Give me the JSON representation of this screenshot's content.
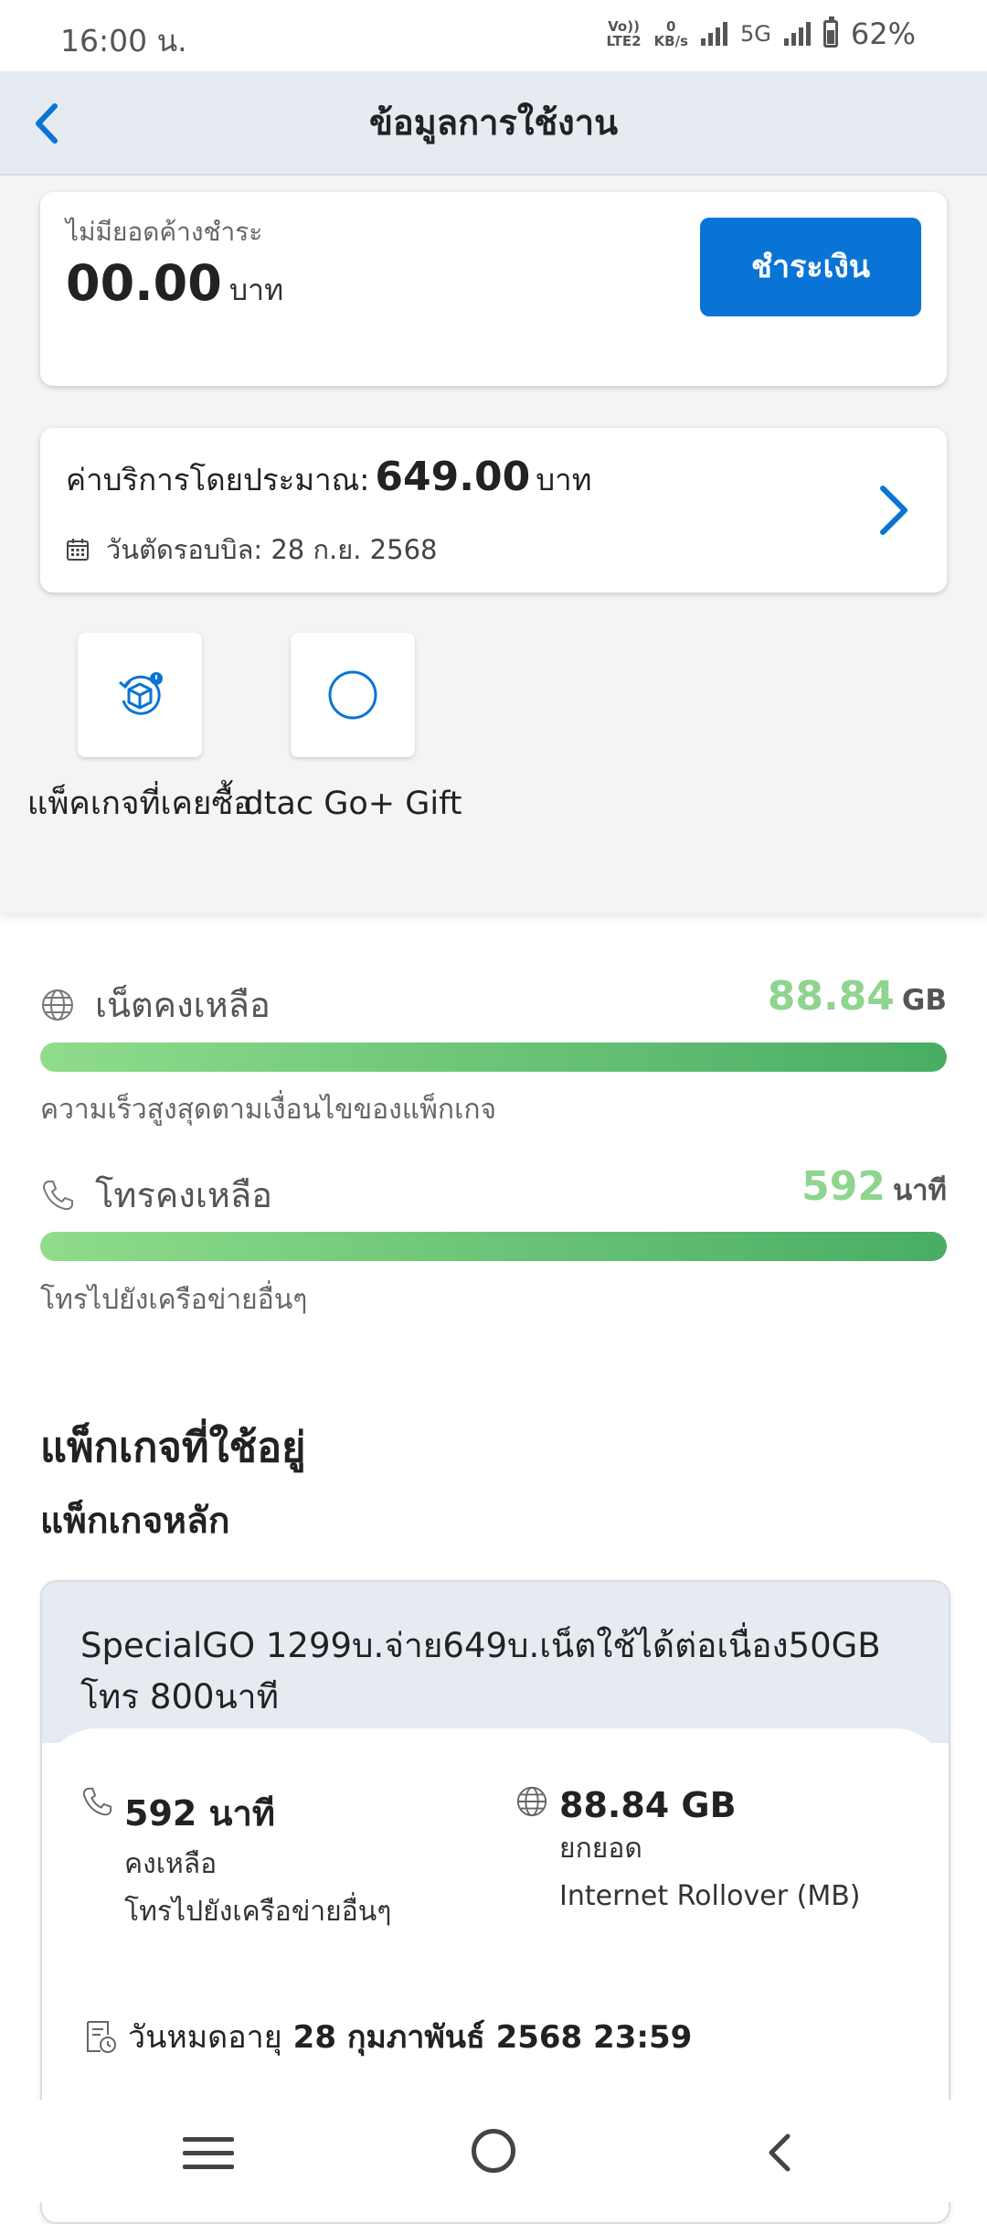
{
  "status_bar": {
    "time": "16:00 น.",
    "volte": "Vo))",
    "lte2": "LTE2",
    "speed_value": "0",
    "speed_unit": "KB/s",
    "network": "5G",
    "battery": "62%"
  },
  "header": {
    "title": "ข้อมูลการใช้งาน",
    "back_icon": "chevron-left-icon"
  },
  "payment": {
    "label": "ไม่มียอดค้างชำระ",
    "amount": "00.00",
    "currency": "บาท",
    "button_label": "ชำระเงิน"
  },
  "bill": {
    "label": "ค่าบริการโดยประมาณ:",
    "amount": "649.00",
    "currency": "บาท",
    "cycle": "วันตัดรอบบิล: 28 ก.ย. 2568"
  },
  "shortcuts": [
    {
      "label": "แพ็คเกจที่เคยซื้อ",
      "icon": "package-history-icon"
    },
    {
      "label": "dtac Go+ Gift",
      "icon": "circle-icon"
    }
  ],
  "usage": {
    "internet": {
      "label": "เน็ตคงเหลือ",
      "value": "88.84",
      "unit": "GB",
      "note": "ความเร็วสูงสุดตามเงื่อนไขของแพ็กเกจ",
      "fill_percent": 100
    },
    "call": {
      "label": "โทรคงเหลือ",
      "value": "592",
      "unit": "นาที",
      "note": "โทรไปยังเครือข่ายอื่นๆ",
      "fill_percent": 100
    }
  },
  "packages": {
    "section_title": "แพ็กเกจที่ใช้อยู่",
    "main_title": "แพ็กเกจหลัก",
    "main": {
      "name": "SpecialGO 1299บ.จ่าย649บ.เน็ตใช้ได้ต่อเนื่อง50GB โทร 800นาที",
      "call_value": "592 นาที",
      "call_sub1": "คงเหลือ",
      "call_sub2": "โทรไปยังเครือข่ายอื่นๆ",
      "net_value": "88.84 GB",
      "net_sub1": "ยกยอด",
      "net_sub2": "Internet Rollover (MB)",
      "expiry_label": "วันหมดอายุ",
      "expiry_value": "28 กุมภาพันธ์ 2568 23:59"
    }
  },
  "colors": {
    "primary_blue": "#0a74d6",
    "usage_green": "#8fd48f",
    "header_bg": "#e5ebf1"
  }
}
